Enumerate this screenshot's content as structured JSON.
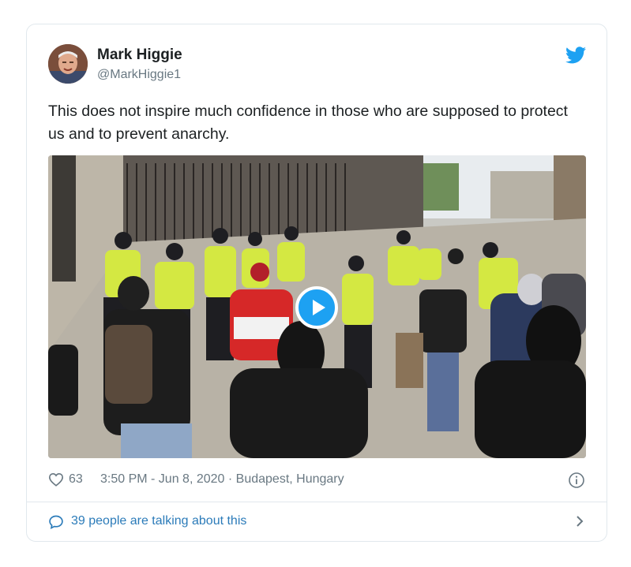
{
  "author": {
    "name": "Mark Higgie",
    "handle": "@MarkHiggie1",
    "avatar_icon": "profile-photo"
  },
  "tweet": {
    "text": "This does not inspire much confidence in those who are supposed to protect us and to prevent anarchy."
  },
  "media": {
    "type": "video",
    "play_icon": "play-icon"
  },
  "meta": {
    "likes": "63",
    "timestamp": "3:50 PM - Jun 8, 2020 · Budapest, Hungary"
  },
  "footer": {
    "talking": "39 people are talking about this"
  },
  "colors": {
    "accent": "#1da1f2",
    "link": "#2b7bb9",
    "muted": "#697882",
    "text": "#1c2022",
    "border": "#e1e8ed"
  }
}
